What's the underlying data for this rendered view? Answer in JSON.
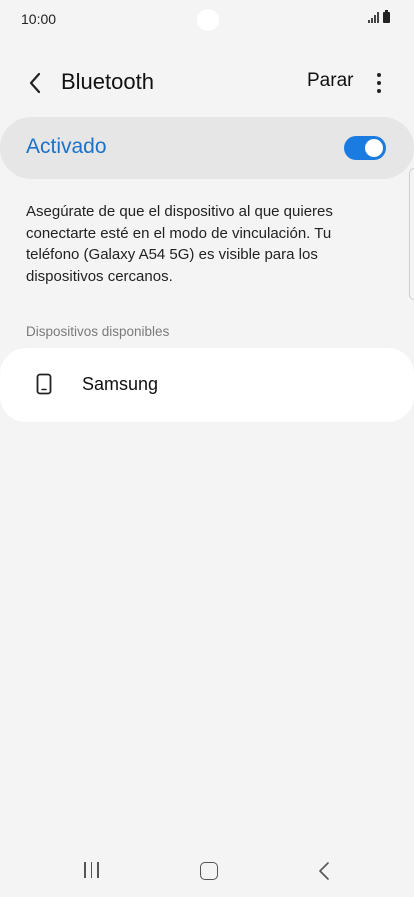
{
  "status_bar": {
    "time": "10:00",
    "icons": [
      "signal-icon",
      "battery-icon"
    ]
  },
  "app_bar": {
    "title": "Bluetooth",
    "stop_label": "Parar",
    "icons": [
      "back-arrow-icon",
      "more-options-icon"
    ]
  },
  "master_switch": {
    "label": "Activado",
    "state": "on",
    "accent_color": "#1a7ce0"
  },
  "info_text": "Asegúrate de que el dispositivo al que quieres conectarte esté en el modo de vinculación. Tu teléfono (Galaxy A54 5G) es visible para los dispositivos cercanos.",
  "available_devices": {
    "header": "Dispositivos disponibles",
    "items": [
      {
        "name": "Samsung",
        "icon": "phone-icon"
      }
    ]
  },
  "nav_bar": {
    "icons": [
      "recent-apps-icon",
      "home-icon",
      "back-icon"
    ]
  }
}
